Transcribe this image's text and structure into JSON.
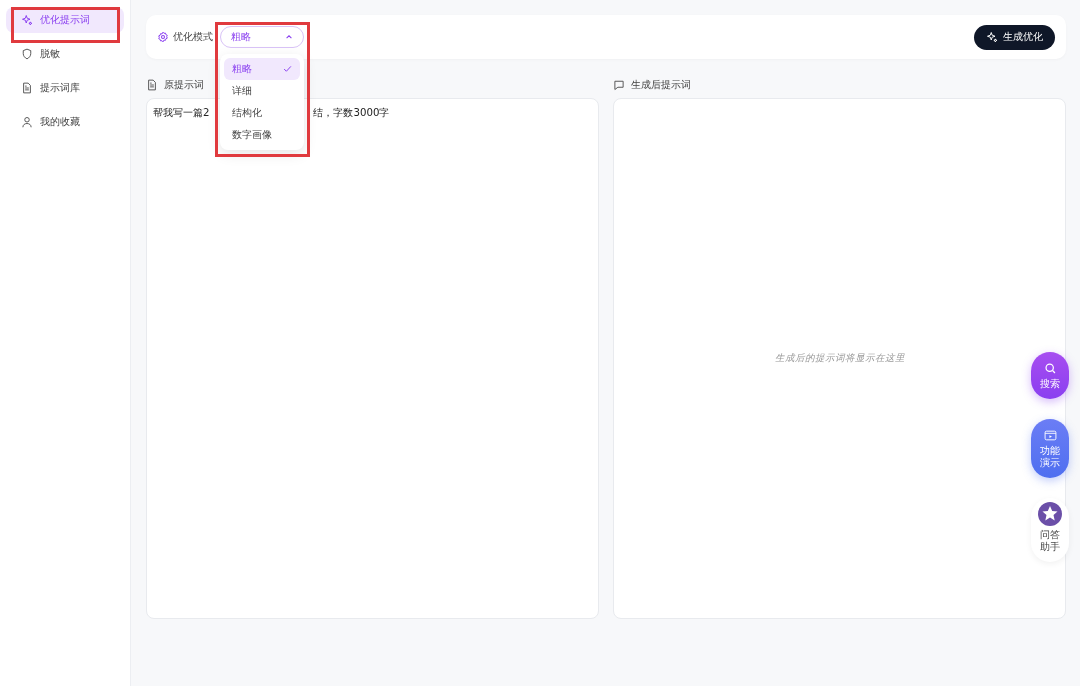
{
  "sidebar": {
    "items": [
      {
        "label": "优化提示词",
        "selected": true,
        "highlighted": true
      },
      {
        "label": "脱敏",
        "selected": false,
        "highlighted": false
      },
      {
        "label": "提示词库",
        "selected": false,
        "highlighted": false
      },
      {
        "label": "我的收藏",
        "selected": false,
        "highlighted": false
      }
    ]
  },
  "toolbar": {
    "mode_label": "优化模式",
    "select": {
      "value": "粗略",
      "expanded": true,
      "highlighted": true,
      "options": [
        {
          "label": "粗略",
          "selected": true
        },
        {
          "label": "详细",
          "selected": false
        },
        {
          "label": "结构化",
          "selected": false
        },
        {
          "label": "数字画像",
          "selected": false
        }
      ]
    },
    "generate_button": "生成优化"
  },
  "source": {
    "title": "原提示词",
    "text_parts": [
      "帮我写一篇2",
      "结，字数3000字"
    ]
  },
  "result": {
    "title": "生成后提示词",
    "placeholder": "生成后的提示词将显示在这里"
  },
  "floating": [
    {
      "kind": "search",
      "label": "搜索"
    },
    {
      "kind": "demo",
      "label": "功能演示"
    },
    {
      "kind": "assistant",
      "label": "问答助手"
    }
  ]
}
